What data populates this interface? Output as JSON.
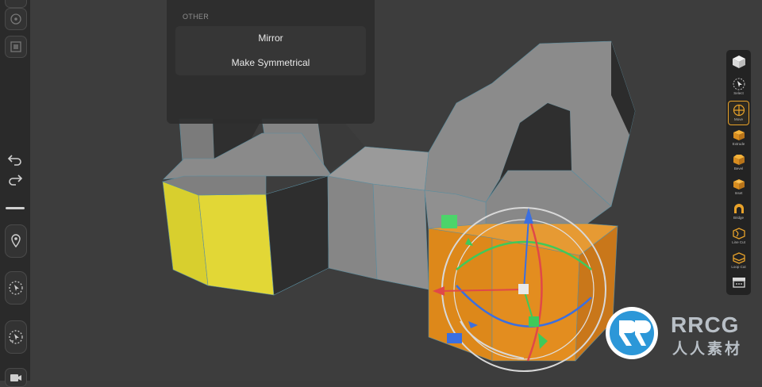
{
  "menu": {
    "section_header": "OTHER",
    "items": [
      {
        "label": "Mirror"
      },
      {
        "label": "Make Symmetrical"
      }
    ]
  },
  "tools": [
    {
      "name": "Primitives",
      "label": "",
      "icon": "cube-icon"
    },
    {
      "name": "Select",
      "label": "Select",
      "icon": "select-cursor-icon"
    },
    {
      "name": "Move",
      "label": "Move",
      "icon": "move-gizmo-icon",
      "active": true
    },
    {
      "name": "Extrude",
      "label": "Extrude",
      "icon": "extrude-icon"
    },
    {
      "name": "Bevel",
      "label": "Bevel",
      "icon": "bevel-icon"
    },
    {
      "name": "Inset",
      "label": "Inset",
      "icon": "inset-icon"
    },
    {
      "name": "Bridge",
      "label": "Bridge",
      "icon": "bridge-icon"
    },
    {
      "name": "Line Cut",
      "label": "Line Cut",
      "icon": "line-cut-icon"
    },
    {
      "name": "Loop Cut",
      "label": "Loop Cut",
      "icon": "loop-cut-icon"
    },
    {
      "name": "More",
      "label": "",
      "icon": "more-menu-icon"
    }
  ],
  "watermark": {
    "title": "RRCG",
    "subtitle": "人人素材"
  },
  "colors": {
    "selected_face": "#dfd533",
    "moving_face": "#e08a1c",
    "mesh": "#8e8e8e",
    "accent": "#e8a22a",
    "gizmo_x": "#e04848",
    "gizmo_y": "#3fc95a",
    "gizmo_z": "#3b6fe0"
  }
}
